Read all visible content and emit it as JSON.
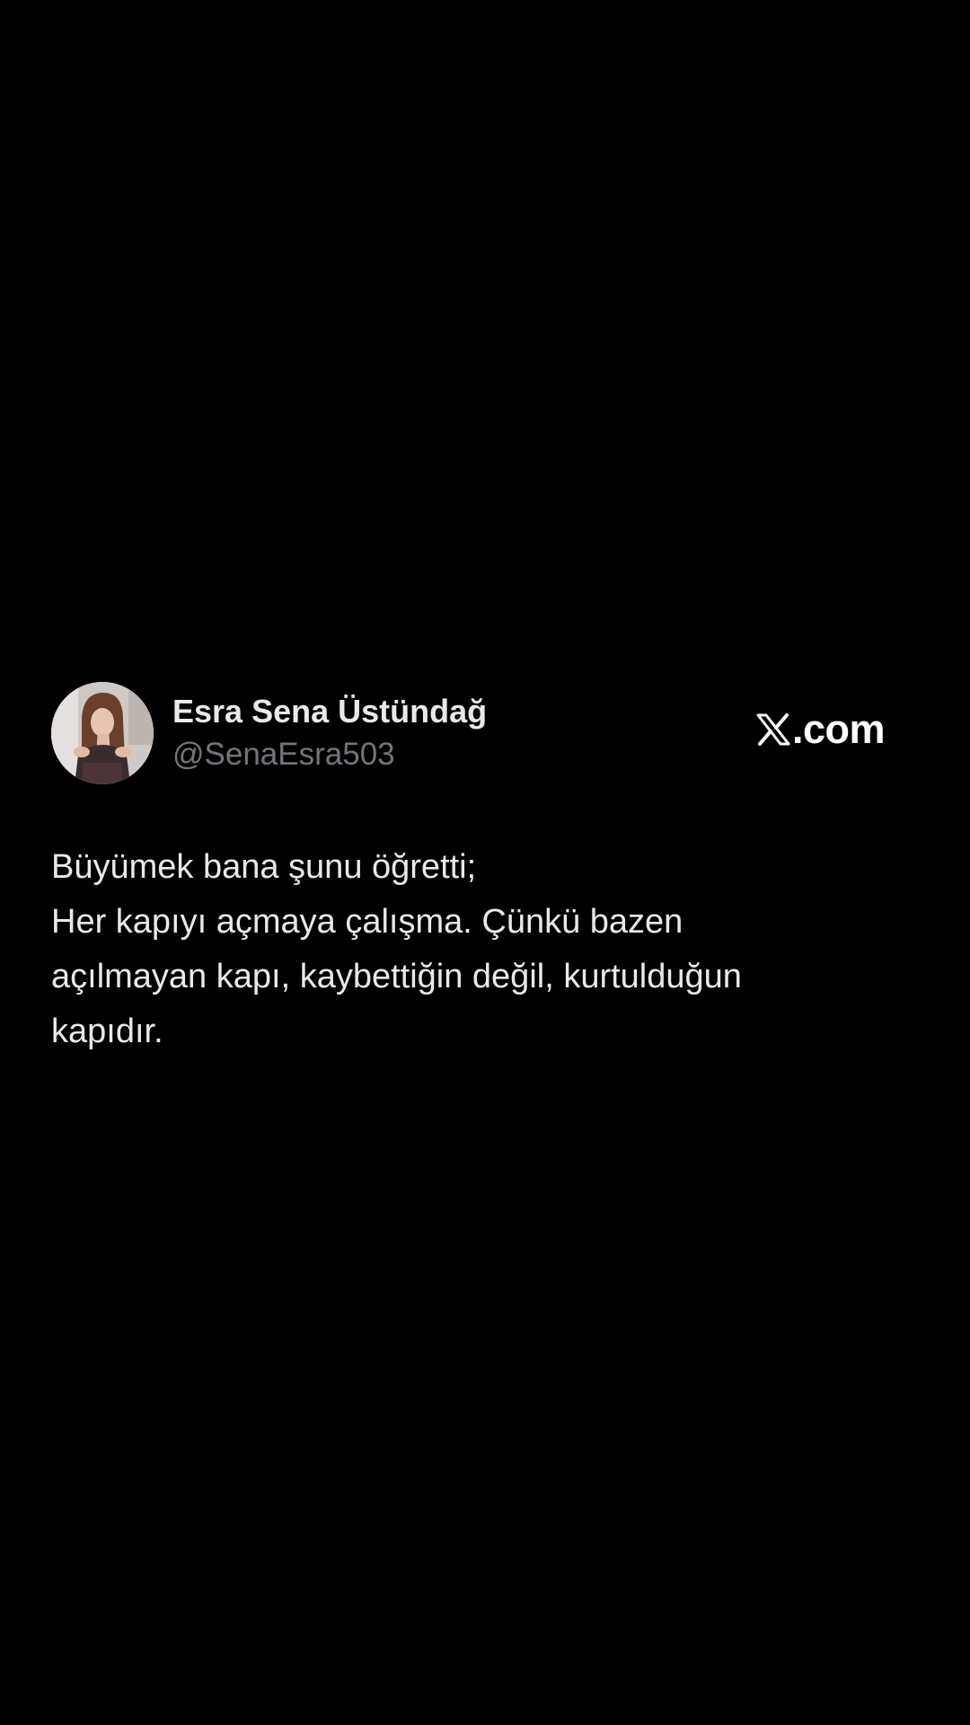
{
  "tweet": {
    "author": {
      "display_name": "Esra Sena Üstündağ",
      "handle": "@SenaEsra503"
    },
    "brand": {
      "icon": "x-logo-icon",
      "domain": ".com"
    },
    "text_lines": [
      "Büyümek bana şunu öğretti;",
      "Her kapıyı açmaya çalışma. Çünkü bazen",
      "açılmayan kapı, kaybettiğin değil, kurtulduğun",
      "kapıdır."
    ]
  },
  "colors": {
    "background": "#000000",
    "primary_text": "#e7e9ea",
    "secondary_text": "#71767b",
    "brand_text": "#ffffff"
  }
}
